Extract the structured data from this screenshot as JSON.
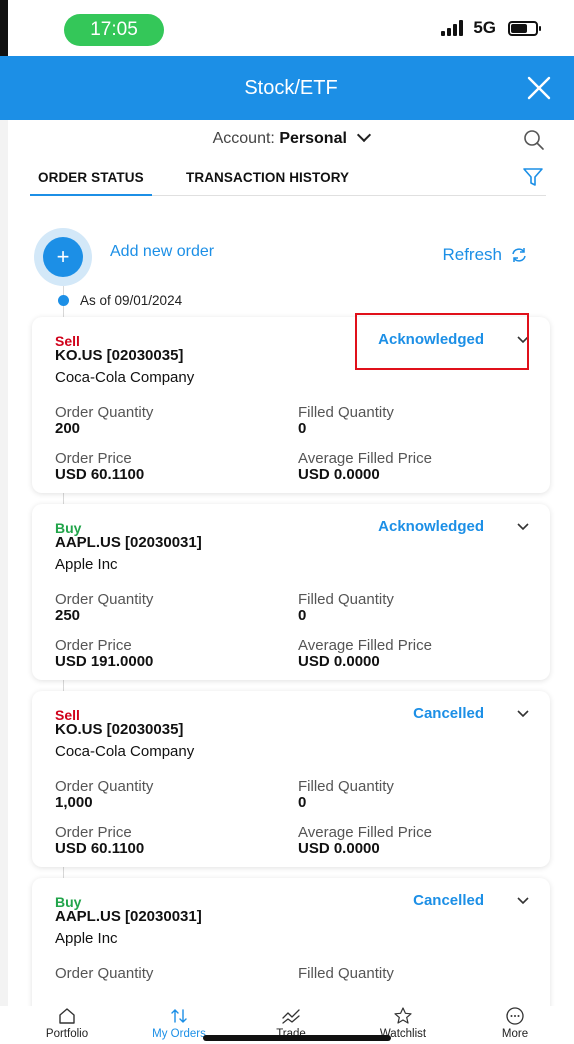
{
  "status_bar": {
    "time": "17:05",
    "network": "5G",
    "battery_level": 0.65
  },
  "header": {
    "title": "Stock/ETF",
    "close_icon": "close-icon"
  },
  "account": {
    "label": "Account:",
    "value": "Personal"
  },
  "tabs": [
    {
      "label": "ORDER STATUS",
      "active": true
    },
    {
      "label": "TRANSACTION HISTORY",
      "active": false
    }
  ],
  "actions": {
    "add_label": "Add new order",
    "refresh_label": "Refresh"
  },
  "as_of": "As of 09/01/2024",
  "field_labels": {
    "order_quantity": "Order Quantity",
    "filled_quantity": "Filled Quantity",
    "order_price": "Order Price",
    "average_filled_price": "Average Filled Price"
  },
  "orders": [
    {
      "side": "Sell",
      "symbol": "KO.US [02030035]",
      "company": "Coca-Cola Company",
      "status": "Acknowledged",
      "order_quantity": "200",
      "filled_quantity": "0",
      "order_price": "USD 60.1100",
      "average_filled_price": "USD 0.0000"
    },
    {
      "side": "Buy",
      "symbol": "AAPL.US [02030031]",
      "company": "Apple Inc",
      "status": "Acknowledged",
      "order_quantity": "250",
      "filled_quantity": "0",
      "order_price": "USD 191.0000",
      "average_filled_price": "USD 0.0000"
    },
    {
      "side": "Sell",
      "symbol": "KO.US [02030035]",
      "company": "Coca-Cola Company",
      "status": "Cancelled",
      "order_quantity": "1,000",
      "filled_quantity": "0",
      "order_price": "USD 60.1100",
      "average_filled_price": "USD 0.0000"
    },
    {
      "side": "Buy",
      "symbol": "AAPL.US [02030031]",
      "company": "Apple Inc",
      "status": "Cancelled",
      "order_quantity": "",
      "filled_quantity": "",
      "order_price": "",
      "average_filled_price": ""
    }
  ],
  "bottom_nav": [
    {
      "label": "Portfolio",
      "icon": "home-icon",
      "active": false
    },
    {
      "label": "My Orders",
      "icon": "orders-icon",
      "active": true
    },
    {
      "label": "Trade",
      "icon": "trade-icon",
      "active": false
    },
    {
      "label": "Watchlist",
      "icon": "star-icon",
      "active": false
    },
    {
      "label": "More",
      "icon": "more-icon",
      "active": false
    }
  ],
  "colors": {
    "accent": "#1c8fe6",
    "sell": "#d0021b",
    "buy": "#21a44a",
    "status_pill": "#34c759"
  }
}
